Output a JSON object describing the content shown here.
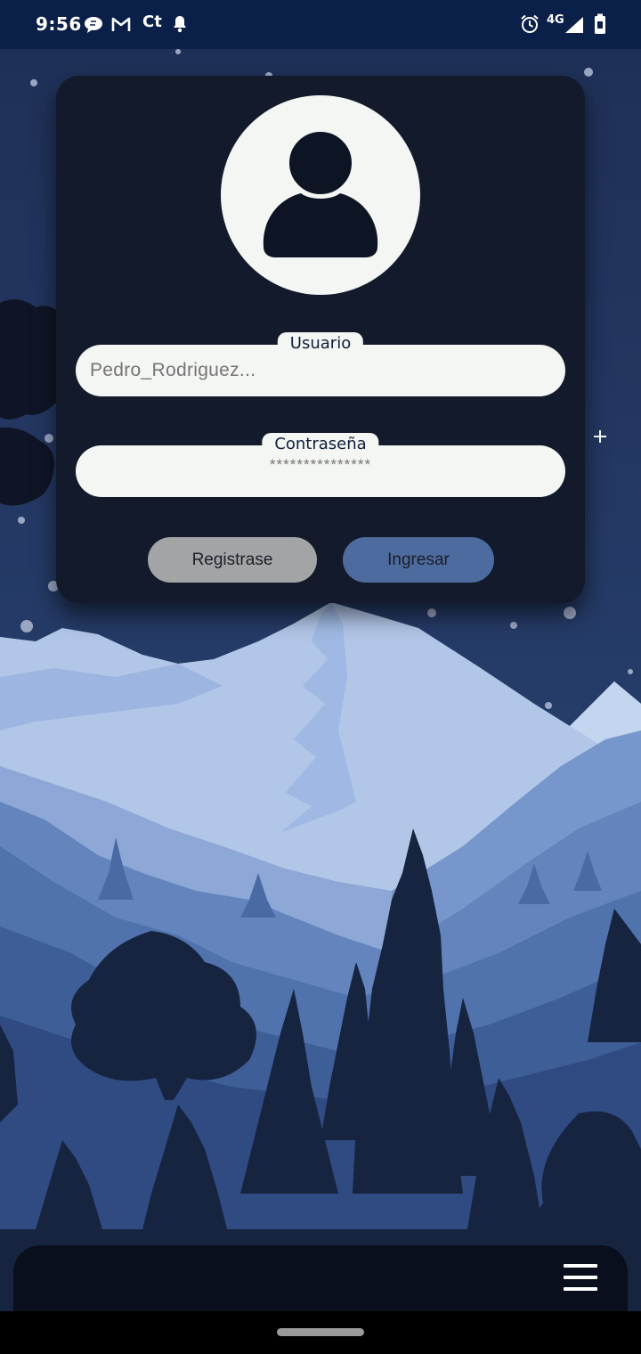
{
  "status_bar": {
    "time": "9:56",
    "network_label": "4G",
    "left_icons": [
      "chat-bubble-icon",
      "gmail-icon",
      "ct-app-icon",
      "notification-bell-icon"
    ],
    "right_icons": [
      "alarm-clock-icon",
      "cellular-signal-icon",
      "battery-icon"
    ]
  },
  "login": {
    "username_label": "Usuario",
    "username_placeholder": "Pedro_Rodriguez...",
    "password_label": "Contraseña",
    "password_placeholder": "***************",
    "register_label": "Registrase",
    "login_label": "Ingresar",
    "avatar_icon": "user-avatar-icon"
  },
  "bottom_bar": {
    "menu_icon": "hamburger-menu-icon"
  },
  "colors": {
    "status_bar": "#0b2049",
    "card": "#121a2b",
    "field_bg": "#f4f6f3",
    "register_button": "#a3a4a6",
    "login_button": "#4d6b9e",
    "sky": "#233763"
  }
}
